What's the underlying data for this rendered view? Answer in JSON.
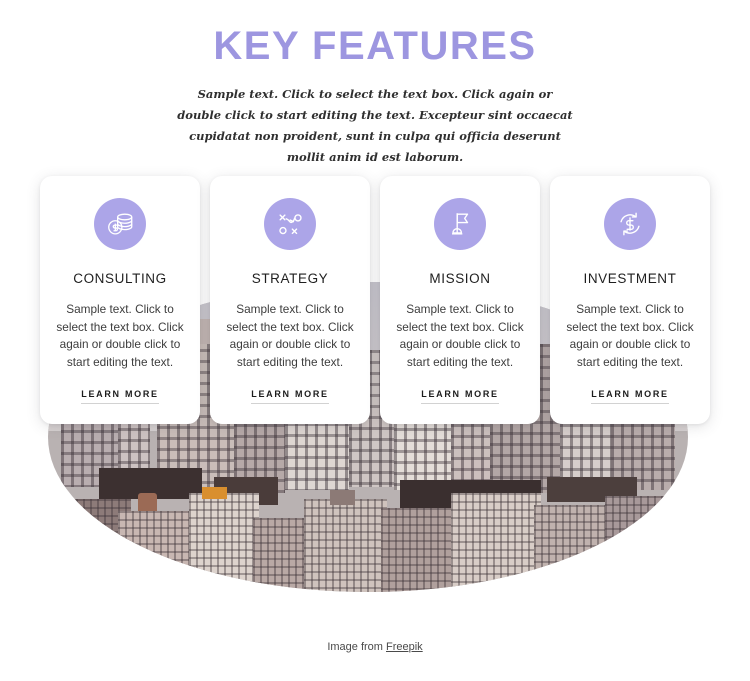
{
  "header": {
    "title": "KEY FEATURES",
    "subtitle": "Sample text. Click to select the text box. Click again or double click to start editing the text. Excepteur sint occaecat cupidatat non proident, sunt in culpa qui officia deserunt mollit anim id est laborum.",
    "title_color": "#9d96e0"
  },
  "theme": {
    "accent": "#aca5e8",
    "card_background": "#ffffff",
    "page_background": "#ffffff",
    "body_text": "#3d3d3d"
  },
  "cards": [
    {
      "icon": "coins-stack-icon",
      "title": "CONSULTING",
      "text": "Sample text. Click to select the text box. Click again or double click to start editing the text.",
      "link_label": "LEARN MORE"
    },
    {
      "icon": "strategy-tactics-icon",
      "title": "STRATEGY",
      "text": "Sample text. Click to select the text box. Click again or double click to start editing the text.",
      "link_label": "LEARN MORE"
    },
    {
      "icon": "flag-icon",
      "title": "MISSION",
      "text": "Sample text. Click to select the text box. Click again or double click to start editing the text.",
      "link_label": "LEARN MORE"
    },
    {
      "icon": "money-exchange-icon",
      "title": "INVESTMENT",
      "text": "Sample text. Click to select the text box. Click again or double click to start editing the text.",
      "link_label": "LEARN MORE"
    }
  ],
  "hero_image": {
    "alt": "city-skyline-photo",
    "shape": "circle-clip"
  },
  "credit": {
    "prefix": "Image from ",
    "link_label": "Freepik"
  }
}
